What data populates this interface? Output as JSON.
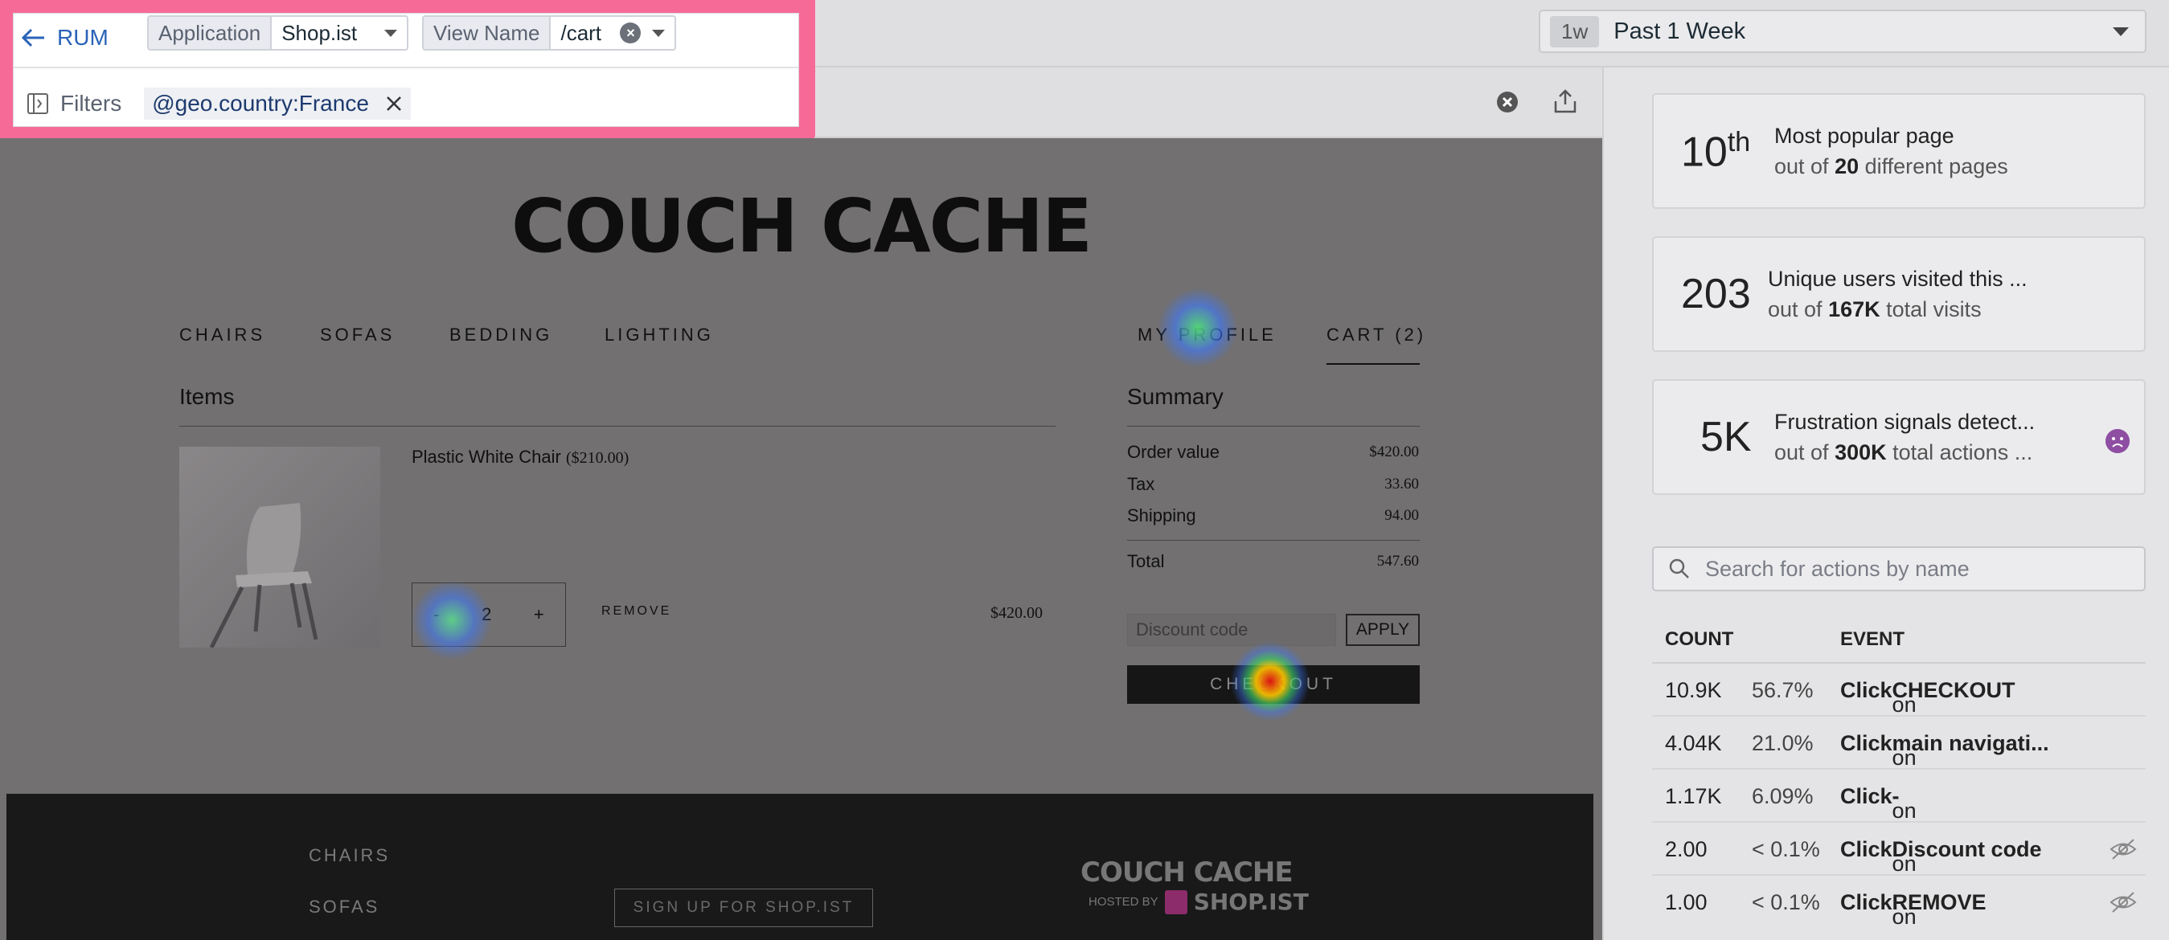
{
  "topbar": {
    "back_label": "RUM",
    "application_label": "Application",
    "application_value": "Shop.ist",
    "view_name_label": "View Name",
    "view_name_value": "/cart",
    "filters_label": "Filters",
    "filter_chip": "@geo.country:France",
    "time_pill": "1w",
    "time_label": "Past 1 Week"
  },
  "site": {
    "brand": "COUCH CACHE",
    "nav": [
      "CHAIRS",
      "SOFAS",
      "BEDDING",
      "LIGHTING"
    ],
    "nav_right": [
      "MY PROFILE",
      "CART (2)"
    ],
    "items_heading": "Items",
    "product_name": "Plastic White Chair",
    "product_unit_price": "($210.00)",
    "qty_minus": "-",
    "qty_value": "2",
    "qty_plus": "+",
    "remove_label": "REMOVE",
    "line_total": "$420.00",
    "summary_heading": "Summary",
    "summary": [
      {
        "label": "Order value",
        "value": "$420.00"
      },
      {
        "label": "Tax",
        "value": "33.60"
      },
      {
        "label": "Shipping",
        "value": "94.00"
      },
      {
        "label": "Total",
        "value": "547.60"
      }
    ],
    "discount_placeholder": "Discount code",
    "apply_label": "APPLY",
    "checkout_label": "CHECKOUT",
    "footer_links": [
      "CHAIRS",
      "SOFAS"
    ],
    "signup_label": "SIGN UP FOR SHOP.IST",
    "footer_brand": "COUCH CACHE",
    "hosted_by": "HOSTED BY",
    "hosted_brand": "SHOP.IST"
  },
  "panel": {
    "stats": [
      {
        "big": "10",
        "sup": "th",
        "title": "Most popular page",
        "sub_pre": "out of ",
        "sub_bold": "20",
        "sub_post": " different pages"
      },
      {
        "big": "203",
        "sup": "",
        "title": "Unique users visited this ...",
        "sub_pre": "out of ",
        "sub_bold": "167K",
        "sub_post": " total visits"
      },
      {
        "big": "5K",
        "sup": "",
        "title": "Frustration signals detect...",
        "sub_pre": "out of ",
        "sub_bold": "300K",
        "sub_post": " total actions ..."
      }
    ],
    "search_placeholder": "Search for actions by name",
    "col_count": "COUNT",
    "col_event": "EVENT",
    "rows": [
      {
        "count": "10.9K",
        "pct": "56.7%",
        "verb": "Click",
        "on": " on ",
        "target": "CHECKOUT",
        "hidden": false
      },
      {
        "count": "4.04K",
        "pct": "21.0%",
        "verb": "Click",
        "on": " on ",
        "target": "main navigati...",
        "hidden": false
      },
      {
        "count": "1.17K",
        "pct": "6.09%",
        "verb": "Click",
        "on": " on ",
        "target": "-",
        "hidden": false
      },
      {
        "count": "2.00",
        "pct": "< 0.1%",
        "verb": "Click",
        "on": " on ",
        "target": "Discount code",
        "hidden": true
      },
      {
        "count": "1.00",
        "pct": "< 0.1%",
        "verb": "Click",
        "on": " on ",
        "target": "REMOVE",
        "hidden": true
      }
    ]
  },
  "colors": {
    "highlight": "#f66a98",
    "link": "#2a63b8",
    "frustration": "#8e4ea2"
  }
}
